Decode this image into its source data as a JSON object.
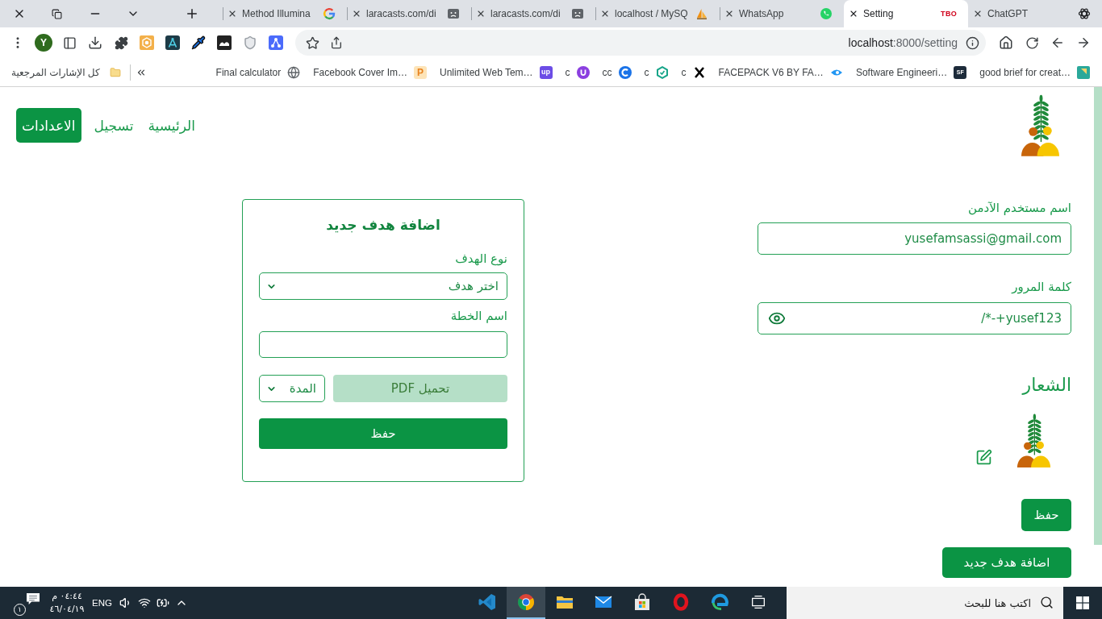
{
  "browser": {
    "tabs": [
      {
        "title": "ChatGPT",
        "selected": false
      },
      {
        "title": "Setting",
        "selected": true,
        "favicon_text": "TBO"
      },
      {
        "title": "WhatsApp",
        "selected": false
      },
      {
        "title": "localhost / MySQ",
        "selected": false
      },
      {
        "title": "laracasts.com/di",
        "selected": false
      },
      {
        "title": "laracasts.com/di",
        "selected": false
      },
      {
        "title": "Method Illumina",
        "selected": false
      }
    ],
    "profile_initial": "Y",
    "address": {
      "host": "localhost",
      "path": ":8000/setting"
    },
    "bookmarks": [
      {
        "label": "good brief for creat…"
      },
      {
        "label": "Software Engineeri…",
        "icon_text": "SF"
      },
      {
        "label": "FACEPACK V6 BY FA…"
      },
      {
        "label": "c"
      },
      {
        "label": "c"
      },
      {
        "label": "cc"
      },
      {
        "label": "c"
      },
      {
        "label": "Unlimited Web Tem…",
        "icon_text": "up"
      },
      {
        "label": "Facebook Cover Im…",
        "icon_text": "P"
      },
      {
        "label": "Final calculator"
      }
    ],
    "bookmarks_folder": "كل الإشارات المرجعية"
  },
  "page": {
    "nav": [
      {
        "label": "الرئيسية",
        "selected": false
      },
      {
        "label": "تسجيل",
        "selected": false
      },
      {
        "label": "الاعدادات",
        "selected": true
      }
    ],
    "admin_settings": {
      "username": {
        "label": "اسم مستخدم الآدمن",
        "value": "yusefamsassi@gmail.com"
      },
      "password": {
        "label": "كلمة المرور",
        "value": "/*-+yusef123"
      },
      "logo_heading": "الشعار",
      "save_button": "حفظ",
      "add_goal_button": "اضافة هدف جديد"
    },
    "goal_form": {
      "title": "اضافة هدف جديد",
      "goal_type": {
        "label": "نوع الهدف",
        "value": "اختر هدف"
      },
      "plan_name": {
        "label": "اسم الخطة"
      },
      "duration": {
        "value": "المدة"
      },
      "upload_button": "تحميل PDF",
      "save_button": "حفظ"
    }
  },
  "taskbar": {
    "notification_count": "١",
    "time": "٠٤:٤٤ م",
    "date": "٤٦/٠٤/١٩",
    "language": "ENG",
    "apps": [
      {
        "selected": false
      },
      {
        "selected": false
      },
      {
        "selected": false
      },
      {
        "selected": false
      },
      {
        "selected": false
      },
      {
        "selected": false
      },
      {
        "selected": true
      },
      {
        "selected": false
      }
    ],
    "search_placeholder": "اكتب هنا للبحث"
  }
}
